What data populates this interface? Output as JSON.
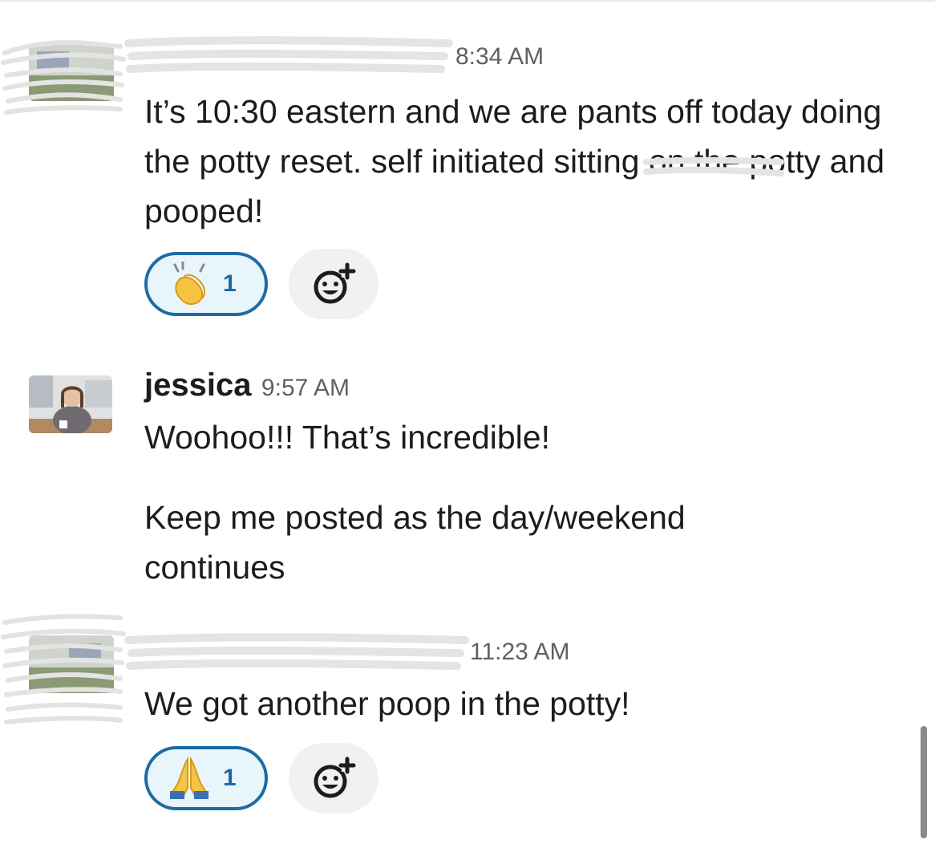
{
  "messages": [
    {
      "author": "",
      "time": "8:34 AM",
      "text": "It’s 10:30 eastern and we are pants off today doing the potty reset. self initiated sitting on the potty and pooped!",
      "reaction": {
        "emoji": "clapping-hands",
        "count": "1"
      },
      "add_reaction_icon": "add-reaction"
    },
    {
      "author": "jessica",
      "time": "9:57 AM",
      "text_lines": [
        "Woohoo!!! That’s incredible!",
        "Keep me posted as the day/weekend continues"
      ]
    },
    {
      "author": "",
      "time": "11:23 AM",
      "text": "We got another poop in the potty!",
      "reaction": {
        "emoji": "folded-hands",
        "count": "1"
      },
      "add_reaction_icon": "add-reaction"
    }
  ]
}
